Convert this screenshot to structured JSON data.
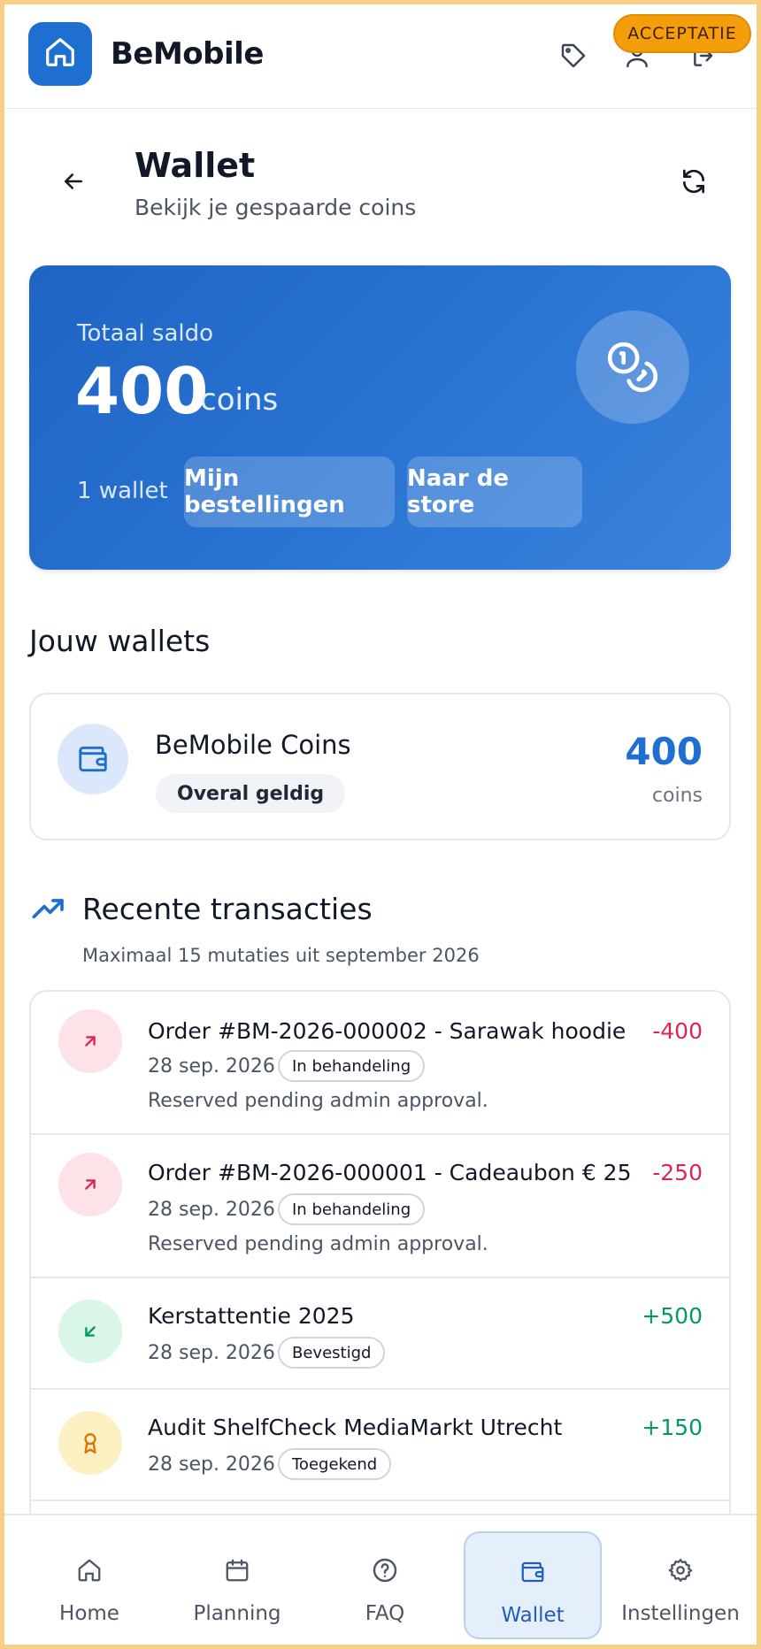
{
  "header": {
    "brand": "BeMobile",
    "env_badge": "ACCEPTATIE",
    "icons": [
      "tag-icon",
      "user-icon",
      "logout-icon"
    ]
  },
  "page": {
    "title": "Wallet",
    "subtitle": "Bekijk je gespaarde coins"
  },
  "balance": {
    "label": "Totaal saldo",
    "amount": "400",
    "unit": "coins",
    "wallet_count": "1 wallet",
    "orders_button": "Mijn bestellingen",
    "store_button": "Naar de store"
  },
  "wallets": {
    "title": "Jouw wallets",
    "items": [
      {
        "name": "BeMobile Coins",
        "chip": "Overal geldig",
        "amount": "400",
        "unit": "coins"
      }
    ]
  },
  "transactions": {
    "title": "Recente transacties",
    "subtitle": "Maximaal 15 mutaties uit september 2026",
    "items": [
      {
        "name": "Order #BM-2026-000002 - Sarawak hoodie",
        "date": "28 sep. 2026",
        "status": "In behandeling",
        "note": "Reserved pending admin approval.",
        "amount": "-400",
        "kind": "debit"
      },
      {
        "name": "Order #BM-2026-000001 - Cadeaubon € 25",
        "date": "28 sep. 2026",
        "status": "In behandeling",
        "note": "Reserved pending admin approval.",
        "amount": "-250",
        "kind": "debit"
      },
      {
        "name": "Kerstattentie 2025",
        "date": "28 sep. 2026",
        "status": "Bevestigd",
        "note": "",
        "amount": "+500",
        "kind": "credit"
      },
      {
        "name": "Audit ShelfCheck MediaMarkt Utrecht",
        "date": "28 sep. 2026",
        "status": "Toegekend",
        "note": "",
        "amount": "+150",
        "kind": "award"
      }
    ]
  },
  "nav": {
    "items": [
      {
        "label": "Home",
        "icon": "home-icon"
      },
      {
        "label": "Planning",
        "icon": "calendar-icon"
      },
      {
        "label": "FAQ",
        "icon": "help-circle-icon"
      },
      {
        "label": "Wallet",
        "icon": "wallet-icon"
      },
      {
        "label": "Instellingen",
        "icon": "gear-icon"
      }
    ],
    "active": "Wallet"
  },
  "colors": {
    "primary": "#1f6fd0",
    "debit": "#dc2650",
    "credit": "#059669",
    "award": "#d97706",
    "badge": "#f59e0b"
  }
}
